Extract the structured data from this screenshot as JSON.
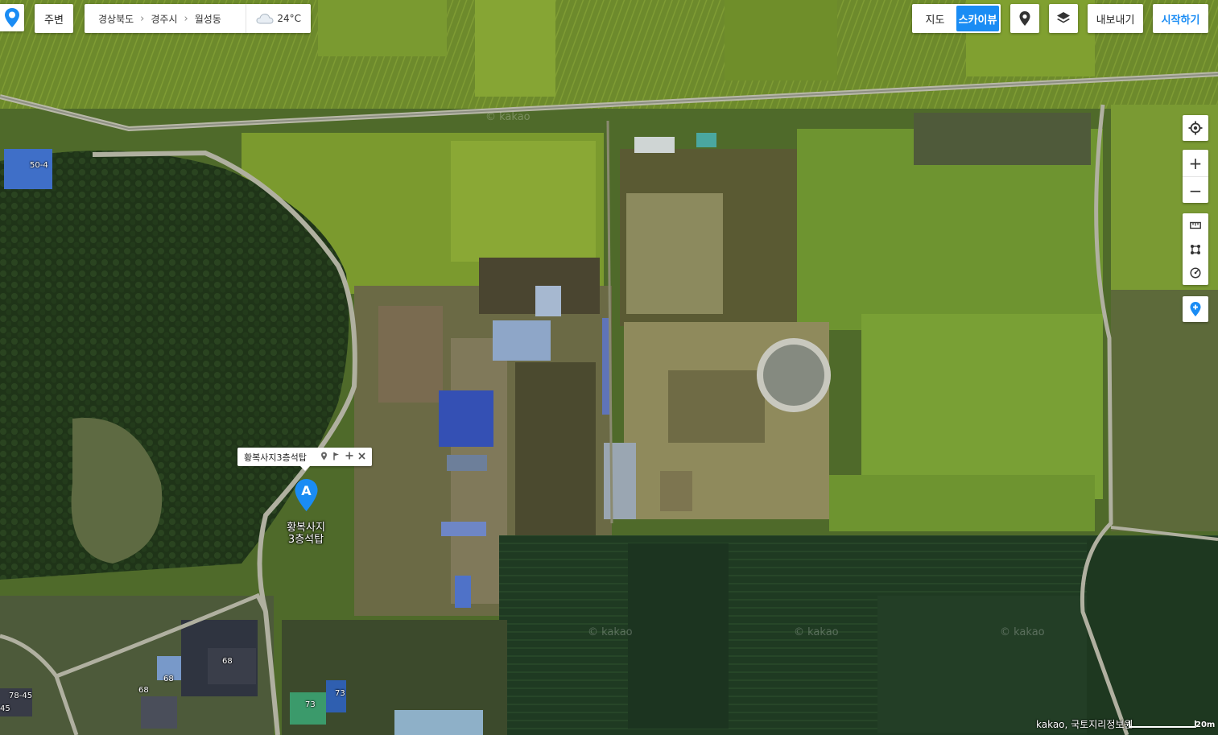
{
  "topbar": {
    "nearby_label": "주변",
    "breadcrumb": [
      "경상북도",
      "경주시",
      "월성동"
    ],
    "weather": {
      "icon": "cloud-icon",
      "temperature": "24°C"
    },
    "map_type": {
      "options": [
        "지도",
        "스카이뷰"
      ],
      "active": "스카이뷰"
    },
    "export_label": "내보내기",
    "start_label": "시작하기"
  },
  "right_controls": {
    "zoom_in": "+",
    "zoom_out": "−",
    "tools": [
      "ruler-icon",
      "area-icon",
      "radius-icon"
    ]
  },
  "marker": {
    "letter": "A",
    "infowindow_title": "황복사지3층석탑",
    "label_line1": "황복사지",
    "label_line2": "3층석탑"
  },
  "map_labels": {
    "buildings": [
      "50-4",
      "68",
      "68",
      "68",
      "73",
      "73",
      "78-45",
      "45"
    ],
    "watermark": "© kakao"
  },
  "footer": {
    "copyright": "kakao, 국토지리정보원",
    "scale": "20m"
  },
  "colors": {
    "accent": "#1a8cf4",
    "marker": "#1a8cf4"
  }
}
